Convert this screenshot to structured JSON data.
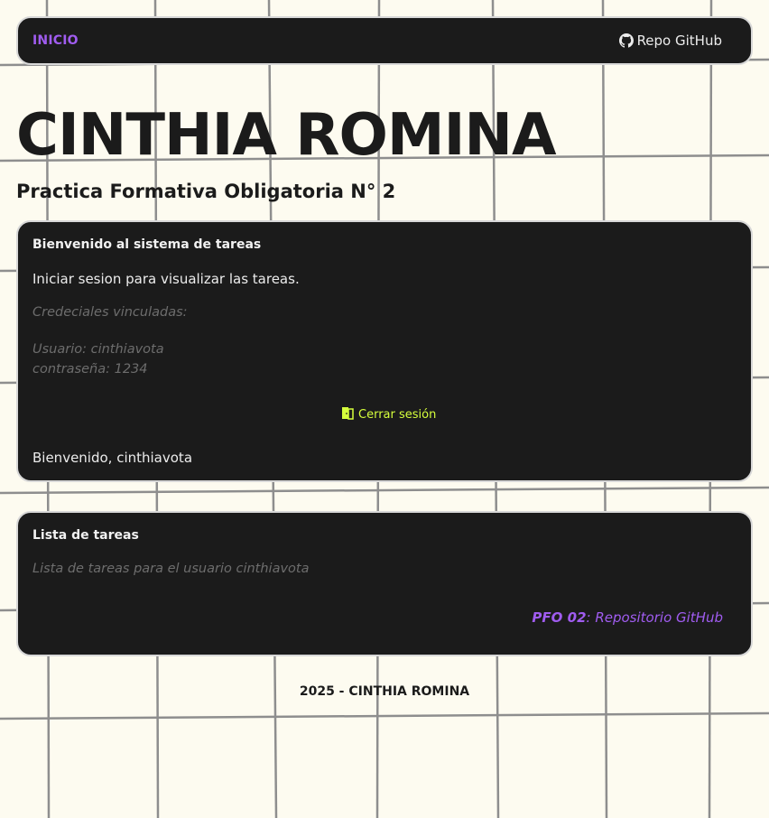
{
  "nav": {
    "home_label": "INICIO",
    "repo_label": "Repo GitHub"
  },
  "header": {
    "title": "CINTHIA ROMINA",
    "subtitle": "Practica Formativa Obligatoria N° 2"
  },
  "login_card": {
    "title": "Bienvenido al sistema de tareas",
    "instruction": "Iniciar sesion para visualizar las tareas.",
    "credentials_heading": "Credeciales vinculadas:",
    "credentials_user": "Usuario: cinthiavota",
    "credentials_password": "contraseña: 1234",
    "logout_label": "Cerrar sesión",
    "welcome_text": "Bienvenido, cinthiavota"
  },
  "tasks_card": {
    "title": "Lista de tareas",
    "description": "Lista de tareas para el usuario cinthiavota",
    "link_bold": "PFO 02",
    "link_rest": ": Repositorio GitHub"
  },
  "footer": {
    "text": "2025 - CINTHIA ROMINA"
  },
  "colors": {
    "background": "#fdfbf0",
    "grid_lines": "#8e8e8e",
    "card_bg": "#1b1b1b",
    "accent_purple": "#a05cf0",
    "accent_lime": "#d6ff3c"
  },
  "icons": {
    "repo": "github-icon",
    "logout": "door-icon"
  }
}
